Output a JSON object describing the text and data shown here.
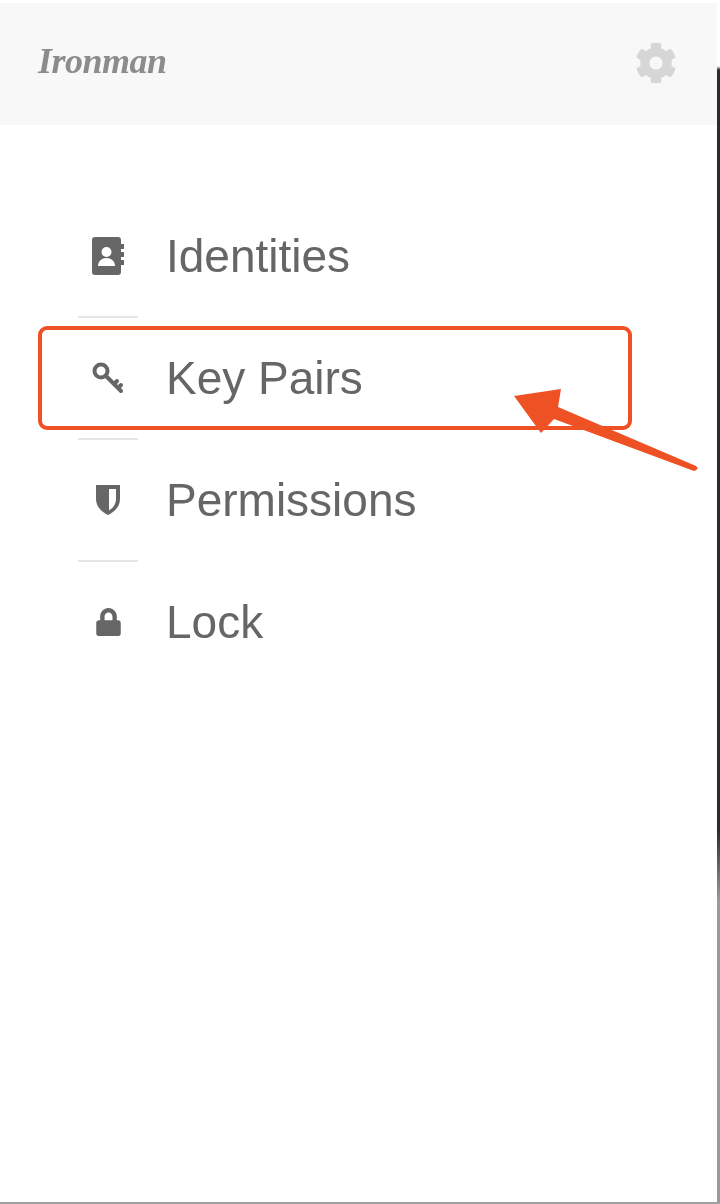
{
  "header": {
    "logo": "Ironman"
  },
  "menu": {
    "items": [
      {
        "label": "Identities",
        "highlighted": false
      },
      {
        "label": "Key Pairs",
        "highlighted": true
      },
      {
        "label": "Permissions",
        "highlighted": false
      },
      {
        "label": "Lock",
        "highlighted": false
      }
    ]
  }
}
